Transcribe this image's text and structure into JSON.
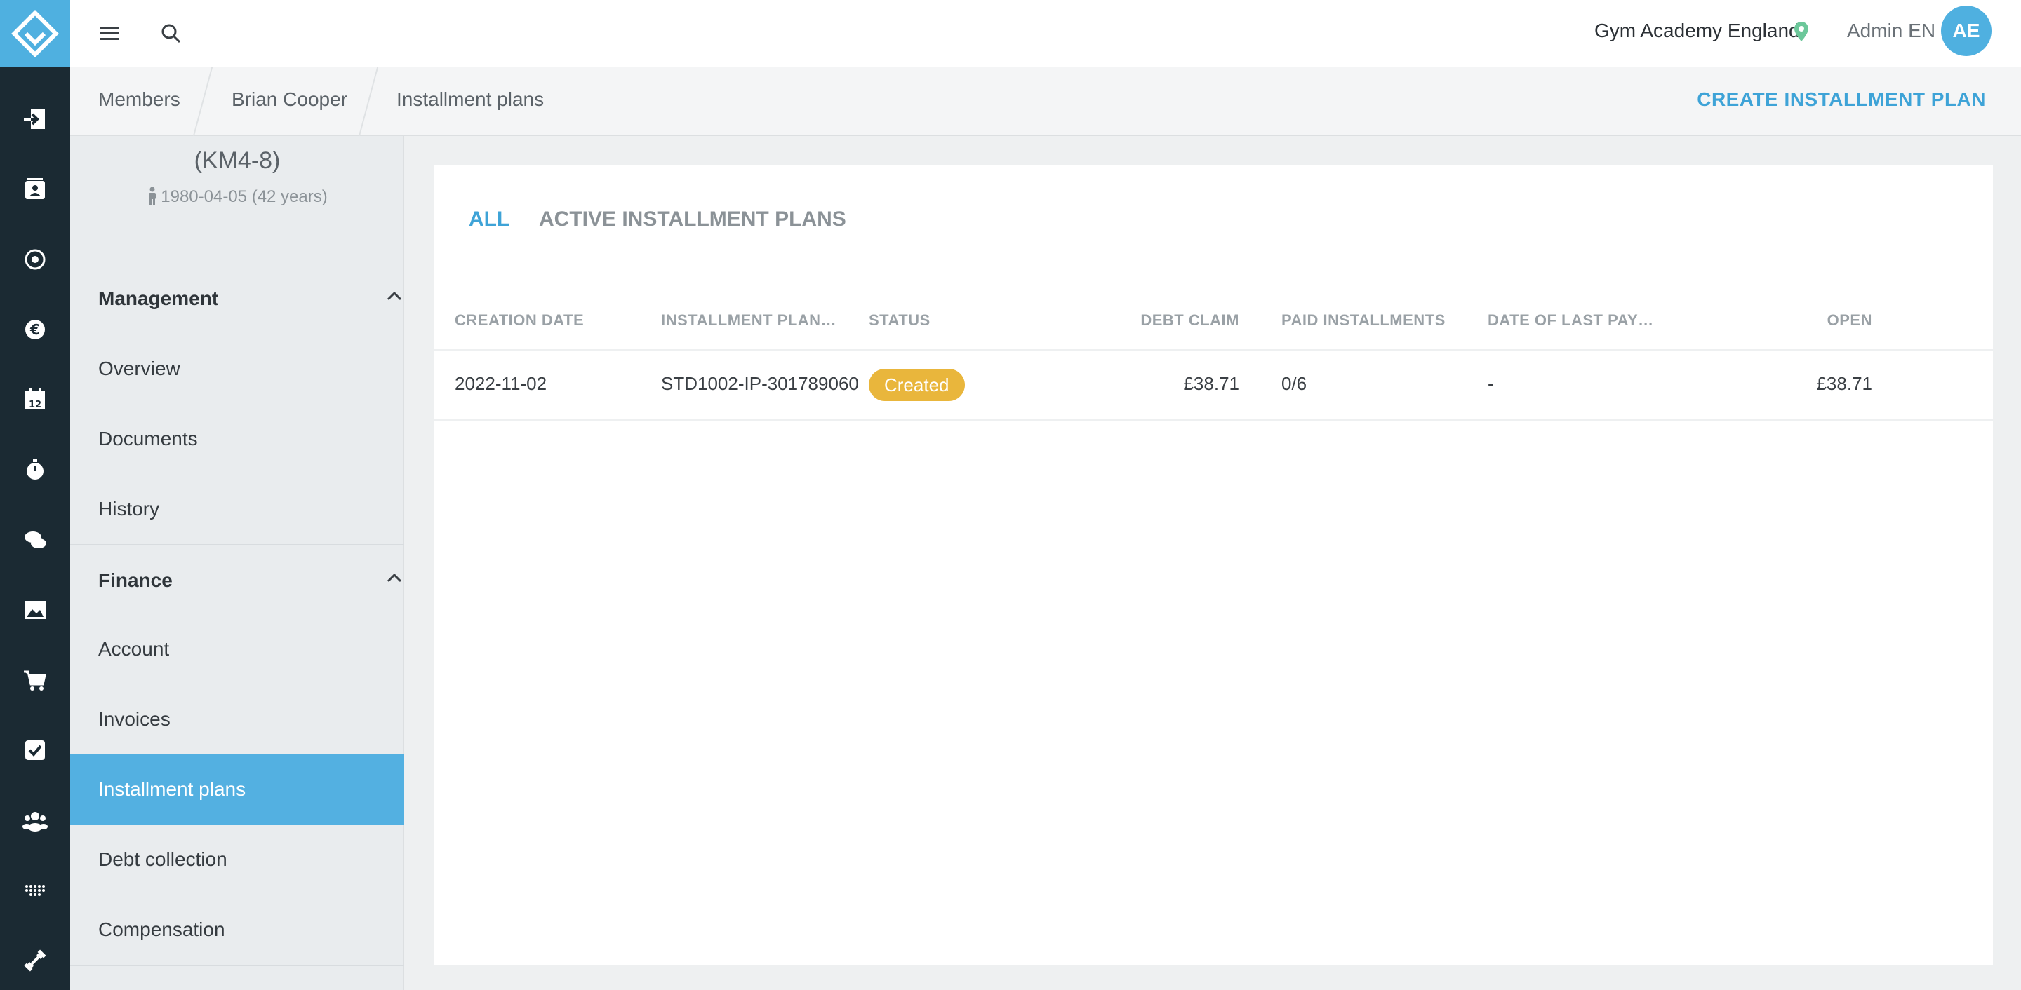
{
  "header": {
    "gym_name": "Gym Academy England",
    "admin_label": "Admin EN",
    "avatar_initials": "AE"
  },
  "breadcrumb": [
    "Members",
    "Brian Cooper",
    "Installment plans"
  ],
  "create_button": "CREATE INSTALLMENT PLAN",
  "member": {
    "id_line": "(KM4-8)",
    "dob_line": "1980-04-05 (42 years)"
  },
  "sidebar": {
    "management": {
      "title": "Management",
      "items": [
        "Overview",
        "Documents",
        "History"
      ]
    },
    "finance": {
      "title": "Finance",
      "items": [
        "Account",
        "Invoices",
        "Installment plans",
        "Debt collection",
        "Compensation"
      ]
    }
  },
  "tabs": [
    "ALL",
    "ACTIVE INSTALLMENT PLANS"
  ],
  "table": {
    "columns": [
      "CREATION DATE",
      "INSTALLMENT PLAN ...",
      "STATUS",
      "DEBT CLAIM",
      "PAID INSTALLMENTS",
      "DATE OF LAST PAYM...",
      "OPEN"
    ],
    "rows": [
      {
        "creation_date": "2022-11-02",
        "plan": "STD1002-IP-301789060",
        "status": "Created",
        "debt_claim": "£38.71",
        "paid": "0/6",
        "last_payment": "-",
        "open": "£38.71"
      }
    ]
  },
  "colors": {
    "accent": "#4fb0e0",
    "rail": "#1b2a33",
    "status_created": "#e9b63c"
  },
  "icons": [
    "menu-icon",
    "search-icon",
    "location-pin-icon",
    "login-icon",
    "member-card-icon",
    "target-icon",
    "euro-icon",
    "calendar-icon",
    "stopwatch-icon",
    "chat-icon",
    "image-icon",
    "cart-icon",
    "checkbox-icon",
    "group-icon",
    "dots-grid-icon",
    "dumbbell-icon",
    "chevron-up-icon",
    "person-icon"
  ]
}
